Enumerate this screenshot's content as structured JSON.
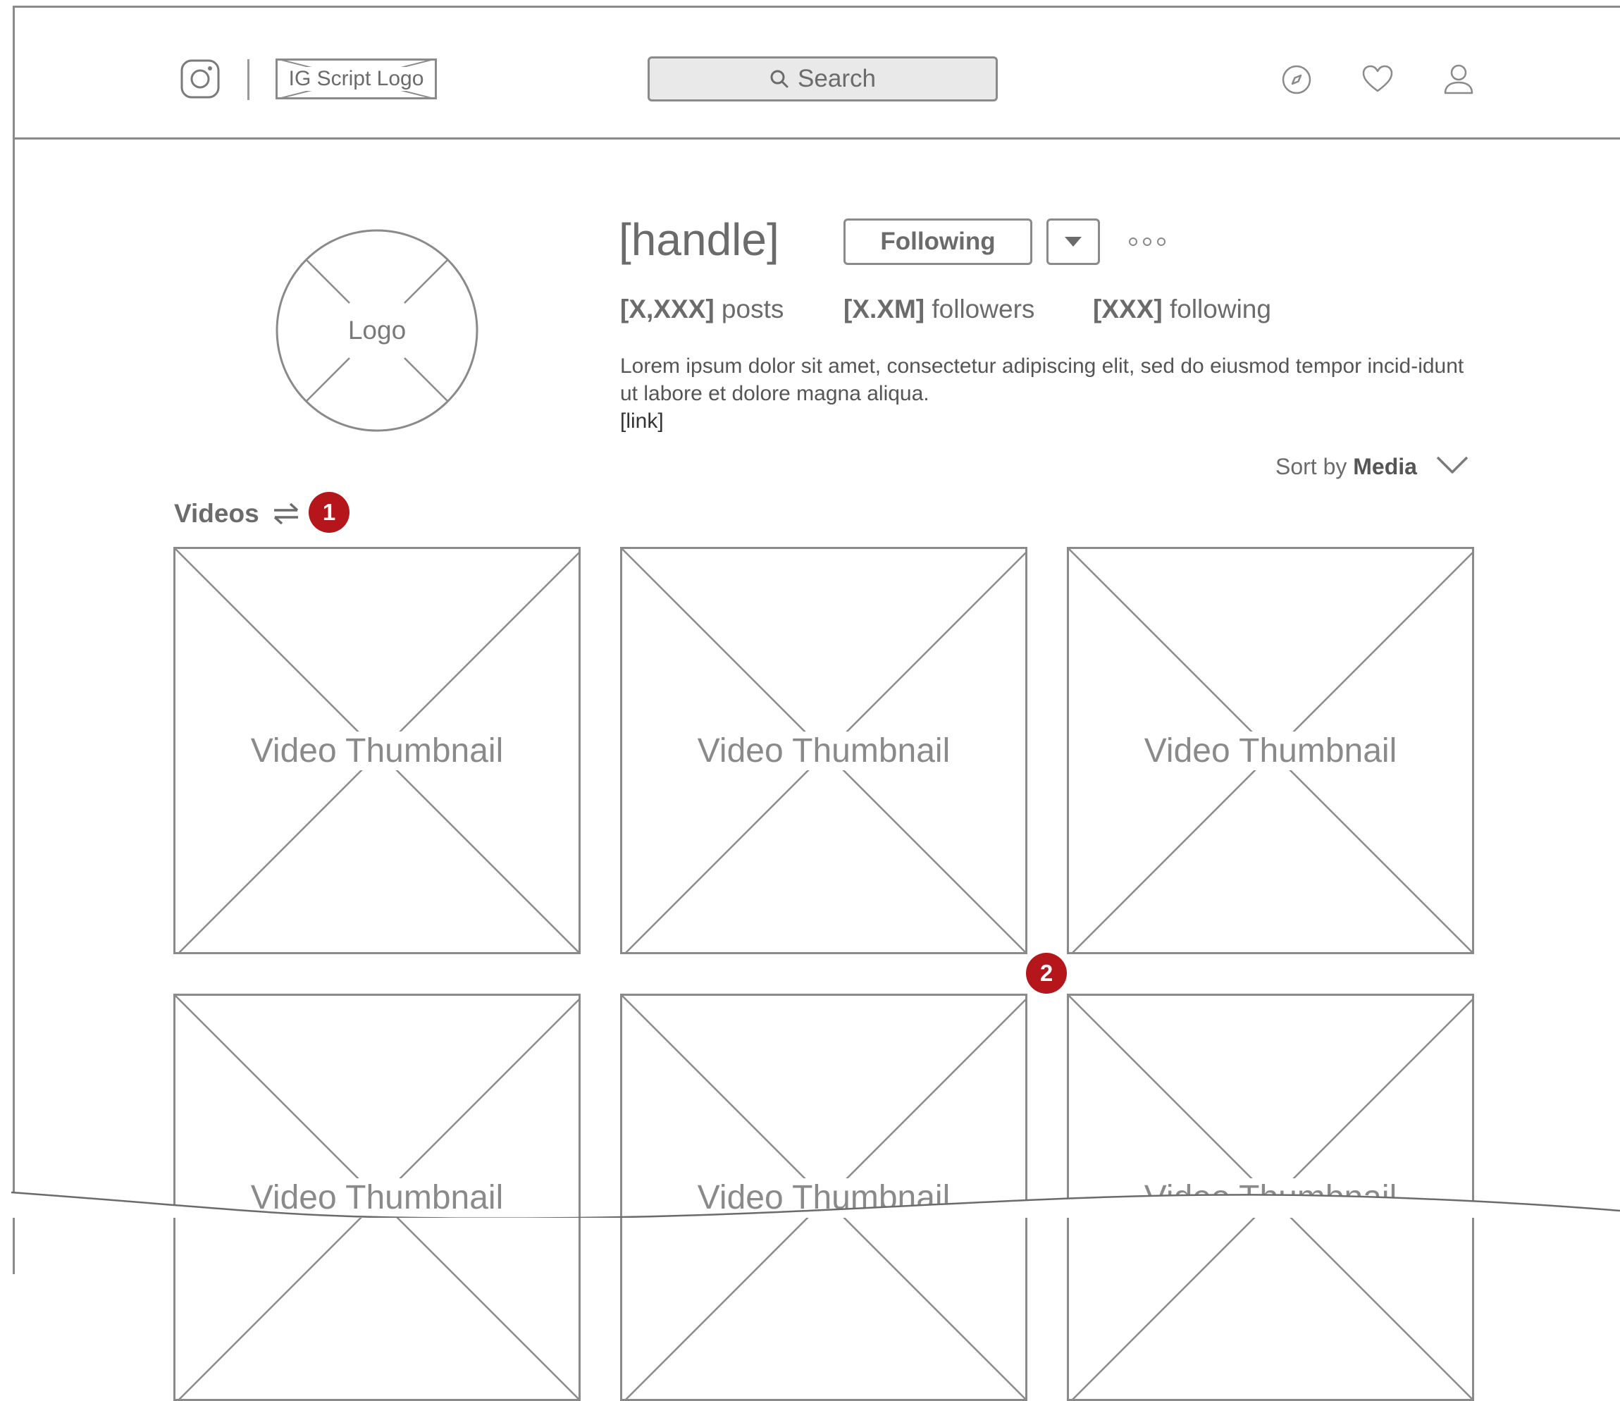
{
  "header": {
    "script_logo": "IG Script Logo",
    "search_label": "Search",
    "icons": [
      "instagram-icon",
      "compass-icon",
      "heart-icon",
      "user-icon"
    ]
  },
  "profile": {
    "logo_label": "Logo",
    "handle": "[handle]",
    "following_button": "Following",
    "stats": {
      "posts_value": "[X,XXX]",
      "posts_label": " posts",
      "followers_value": "[X.XM]",
      "followers_label": " followers",
      "following_value": "[XXX]",
      "following_label": " following"
    },
    "bio": "Lorem ipsum dolor sit amet, consectetur adipiscing elit, sed do eiusmod tempor incid-idunt ut labore et dolore magna aliqua.",
    "link": "[link]"
  },
  "sort": {
    "prefix": "Sort by ",
    "value": "Media"
  },
  "videos": {
    "label": "Videos",
    "thumbnails": [
      "Video Thumbnail",
      "Video Thumbnail",
      "Video Thumbnail",
      "Video Thumbnail",
      "Video Thumbnail",
      "Video Thumbnail"
    ]
  },
  "annotations": {
    "badge_1": "1",
    "badge_2": "2"
  },
  "colors": {
    "wire": "#8a8a8a",
    "badge": "#b5161b",
    "search_bg": "#e9e9ea"
  }
}
